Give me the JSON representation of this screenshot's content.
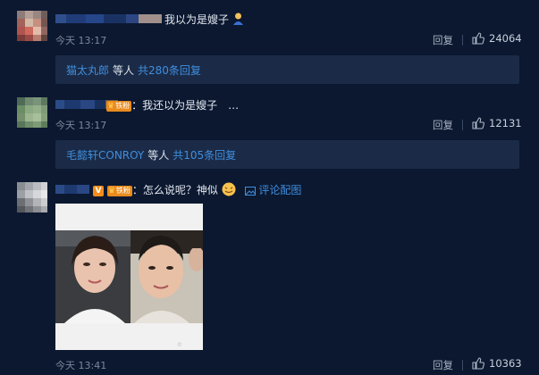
{
  "comments": [
    {
      "text": "我以为是嫂子",
      "emoji": "person-emoji",
      "time": "今天 13:17",
      "reply_label": "回复",
      "likes": "24064",
      "replies": {
        "who": "猫太丸郎",
        "mid": "等人",
        "count": "共280条回复"
      }
    },
    {
      "badge": "铁粉",
      "text": "：我还以为是嫂子　…",
      "time": "今天 13:17",
      "reply_label": "回复",
      "likes": "12131",
      "replies": {
        "who": "毛懿轩CONROY",
        "mid": "等人",
        "count": "共105条回复"
      }
    },
    {
      "verified": "V",
      "badge": "铁粉",
      "text": "：怎么说呢？神似",
      "emoji": "grin-emoji",
      "pic_link": "评论配图",
      "time": "今天 13:41",
      "reply_label": "回复",
      "likes": "10363"
    }
  ],
  "colors": {
    "background": "#0b1830",
    "link": "#3f8ede",
    "reply_box": "#1b2b47",
    "badge": "#e98b1d"
  },
  "icons": [
    "thumbs-up-icon",
    "image-icon",
    "crown-icon"
  ]
}
